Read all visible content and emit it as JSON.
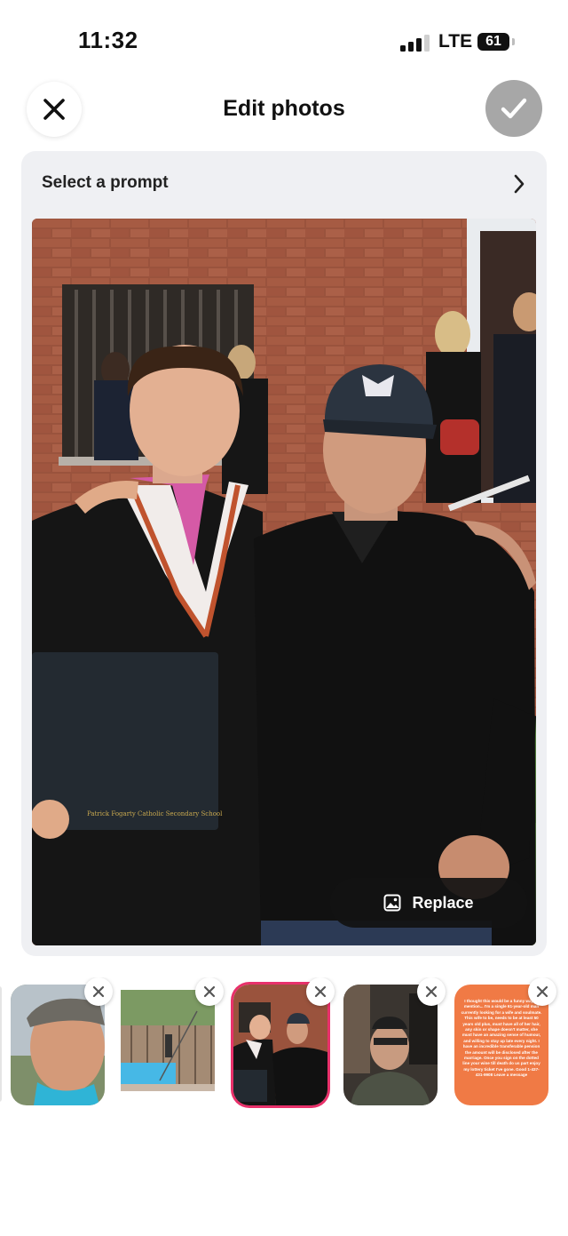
{
  "status_bar": {
    "time": "11:32",
    "network": "LTE",
    "battery": "61"
  },
  "header": {
    "title": "Edit photos",
    "close_icon": "close-icon",
    "done_icon": "checkmark-icon"
  },
  "prompt": {
    "label": "Select a prompt",
    "icon": "chevron-right-icon"
  },
  "main_photo": {
    "description_icon": "photo",
    "diploma_text": "Patrick Fogarty Catholic Secondary School",
    "replace_label": "Replace",
    "replace_icon": "image-icon"
  },
  "thumbnails": [
    {
      "kind": "photo",
      "selected": false
    },
    {
      "kind": "photo",
      "selected": false
    },
    {
      "kind": "photo",
      "selected": true
    },
    {
      "kind": "photo",
      "selected": false
    },
    {
      "kind": "text",
      "selected": false,
      "text": "I thought this would be a funny way to mention... I'm a single 61-year-old man currently looking for a wife and soulmate. This wife to be, needs to be at least 50 years old plus, must have all of her hair, any skin or shape doesn't matter, she must have an amazing sense of humour, and willing to stay up late every night. I have an incredible transferable pension the amount will be disclosed after the marriage. Once you sign on the dotted line your wine till death do us part enjoy my lottery ticket I've gone. Good 1-437-431-9908 Leave a message"
    }
  ],
  "colors": {
    "accent": "#e8316b",
    "card_bg": "#eff0f3",
    "done_button": "#a7a7a7",
    "text_card": "#f07a45"
  }
}
